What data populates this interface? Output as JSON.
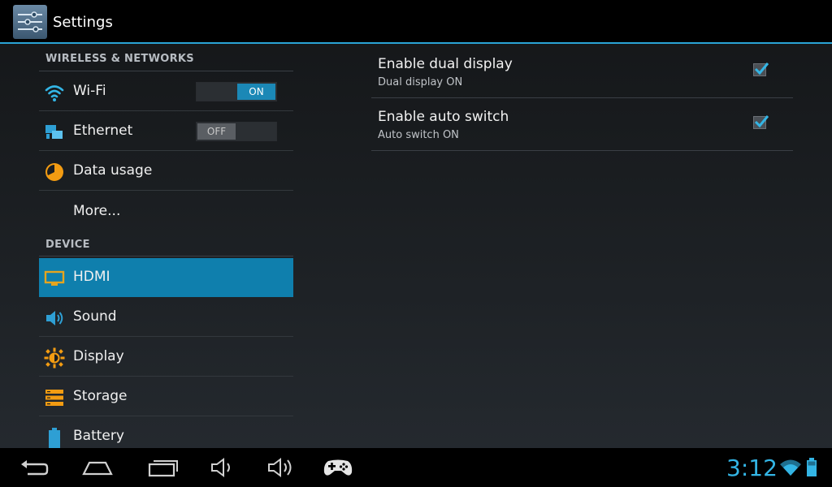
{
  "app": {
    "title": "Settings",
    "icon": "settings-sliders-icon"
  },
  "sidebar": {
    "sections": [
      {
        "header": "WIRELESS & NETWORKS"
      },
      {
        "header": "DEVICE"
      }
    ],
    "items": [
      {
        "label": "Wi-Fi",
        "icon": "wifi-icon",
        "toggle": "ON",
        "toggle_state": true
      },
      {
        "label": "Ethernet",
        "icon": "ethernet-icon",
        "toggle": "OFF",
        "toggle_state": false
      },
      {
        "label": "Data usage",
        "icon": "data-usage-icon"
      },
      {
        "label": "More...",
        "icon": null
      },
      {
        "label": "HDMI",
        "icon": "hdmi-monitor-icon",
        "selected": true
      },
      {
        "label": "Sound",
        "icon": "speaker-icon"
      },
      {
        "label": "Display",
        "icon": "brightness-icon"
      },
      {
        "label": "Storage",
        "icon": "storage-icon"
      },
      {
        "label": "Battery",
        "icon": "battery-icon"
      }
    ]
  },
  "prefs": [
    {
      "title": "Enable dual display",
      "summary": "Dual display ON",
      "checked": true
    },
    {
      "title": "Enable auto switch",
      "summary": "Auto switch ON",
      "checked": true
    }
  ],
  "navbar": {
    "buttons": [
      "back-icon",
      "home-icon",
      "recent-apps-icon",
      "volume-down-icon",
      "volume-up-icon",
      "gamepad-icon"
    ],
    "clock": "3:12",
    "status_icons": [
      "wifi-signal-icon",
      "battery-icon"
    ]
  },
  "colors": {
    "accent": "#33b5e5",
    "selected": "#0f7fad",
    "action_bar": "#000000"
  }
}
